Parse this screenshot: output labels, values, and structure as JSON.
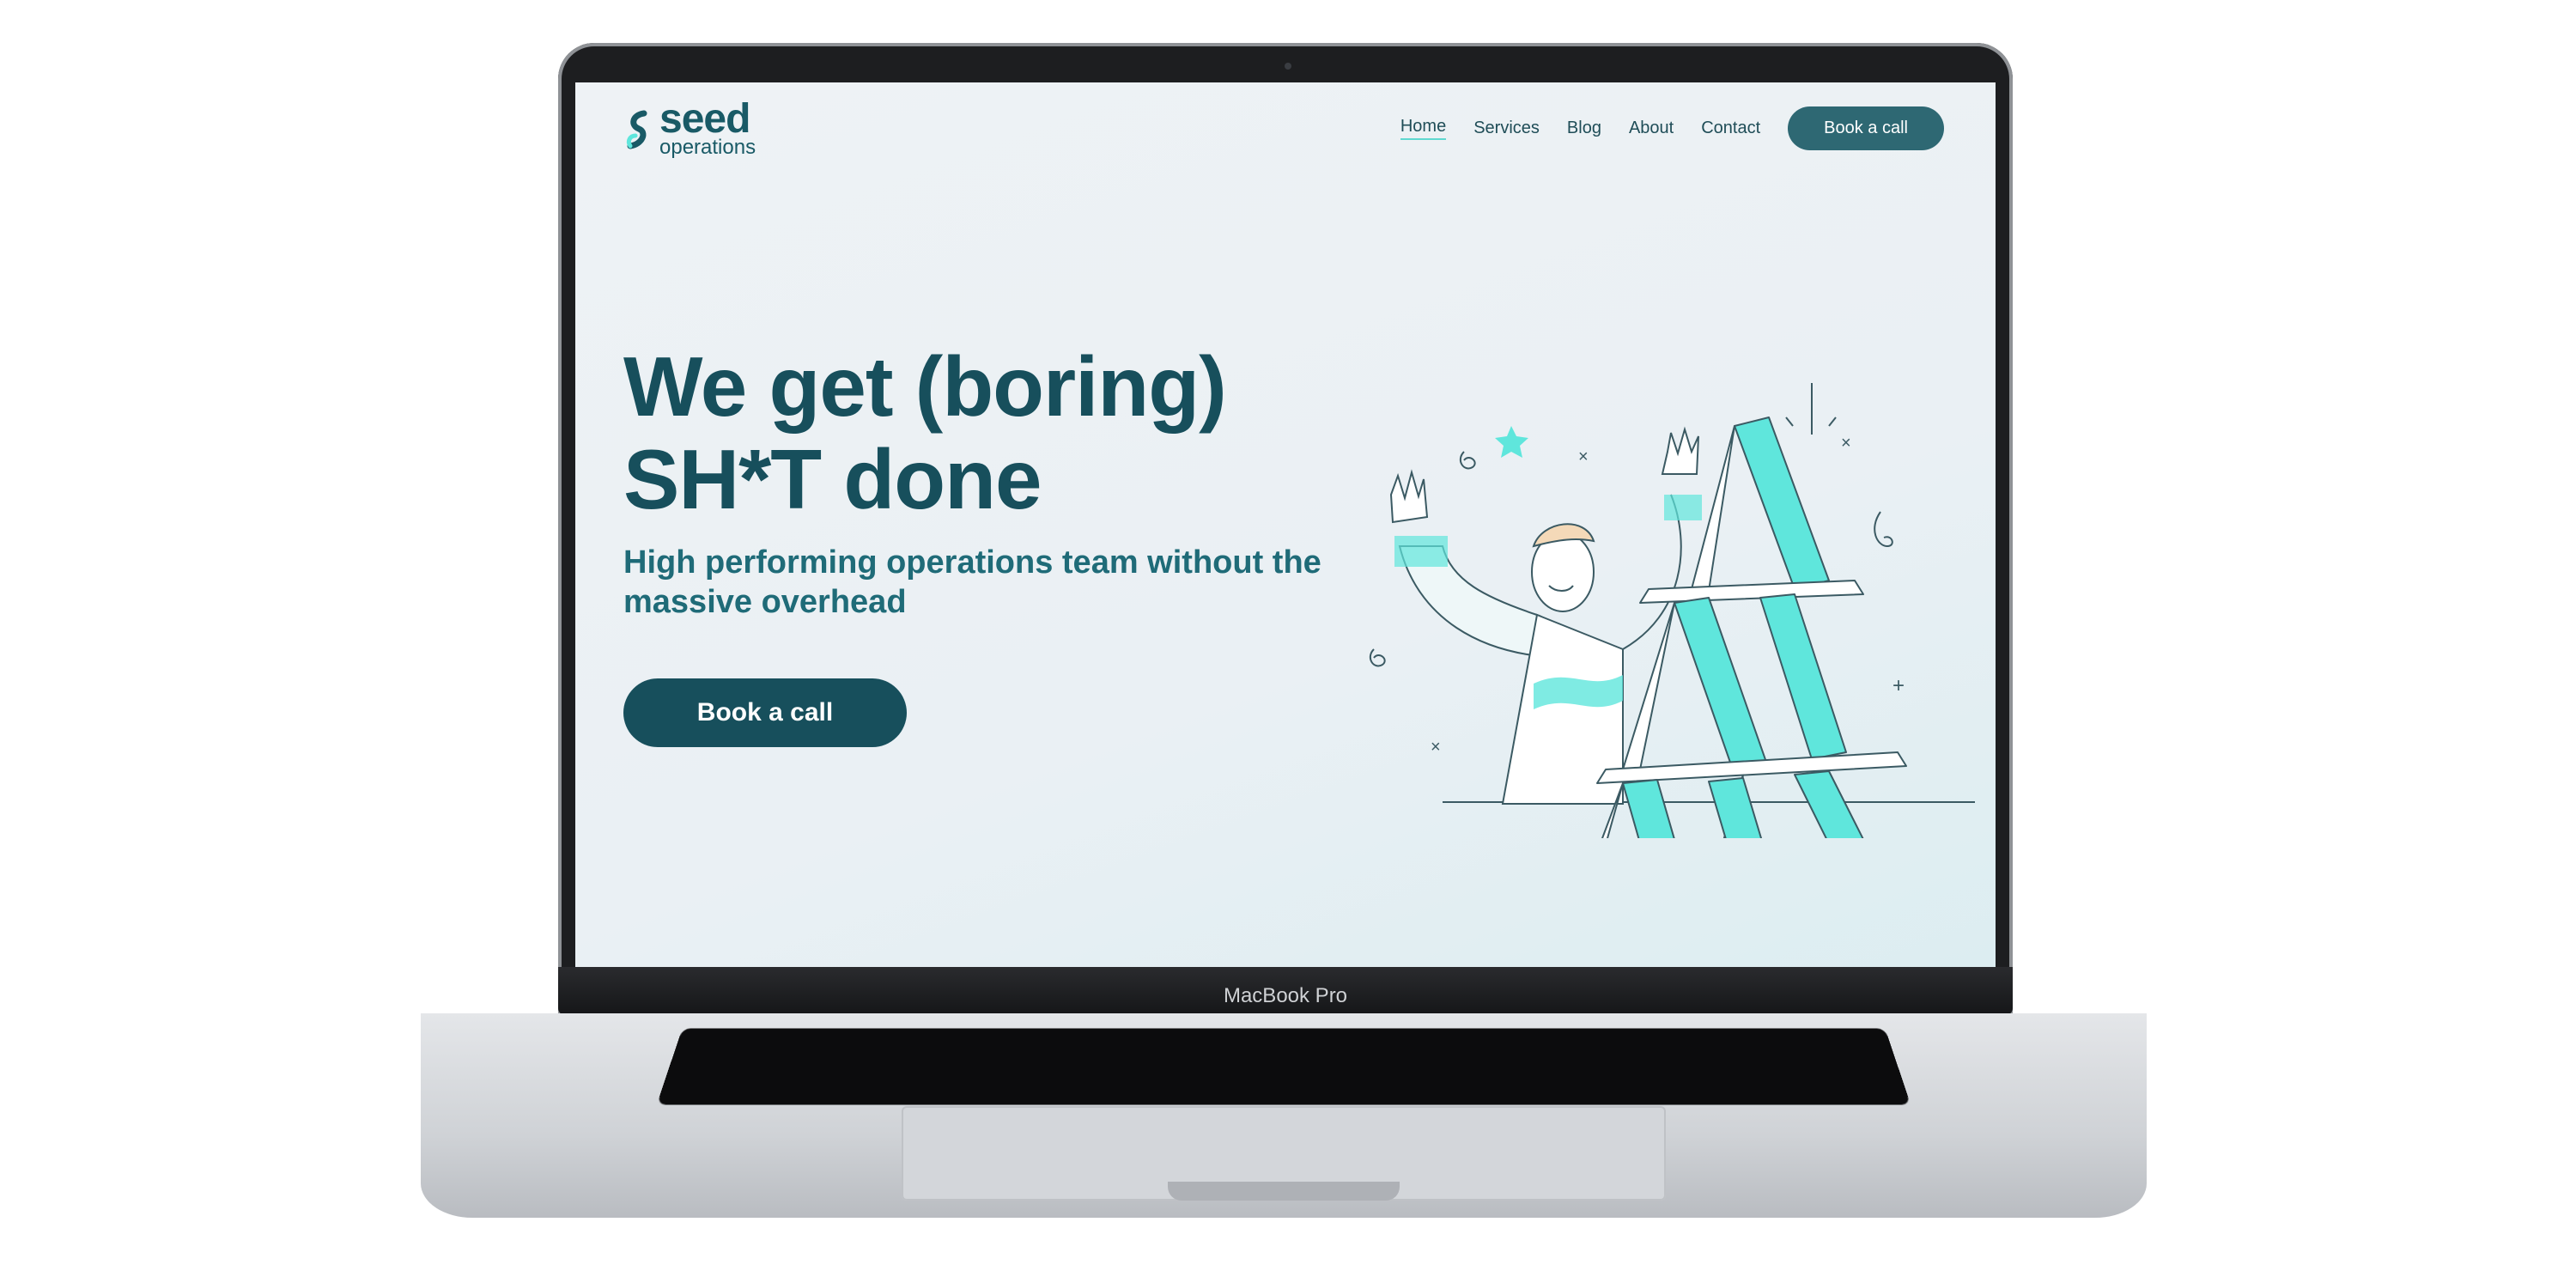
{
  "device": {
    "label": "MacBook Pro"
  },
  "site": {
    "logo": {
      "word": "seed",
      "sub": "operations"
    },
    "nav": [
      {
        "label": "Home",
        "active": true
      },
      {
        "label": "Services"
      },
      {
        "label": "Blog"
      },
      {
        "label": "About"
      },
      {
        "label": "Contact"
      }
    ],
    "nav_cta": "Book a call",
    "hero": {
      "headline_line1": "We get (boring)",
      "headline_line2": "SH*T done",
      "subheadline": "High performing operations team without the massive overhead",
      "cta": "Book a call"
    },
    "colors": {
      "primary": "#174f5c",
      "accent": "#5fe6dc",
      "nav_button": "#2e6873"
    }
  }
}
